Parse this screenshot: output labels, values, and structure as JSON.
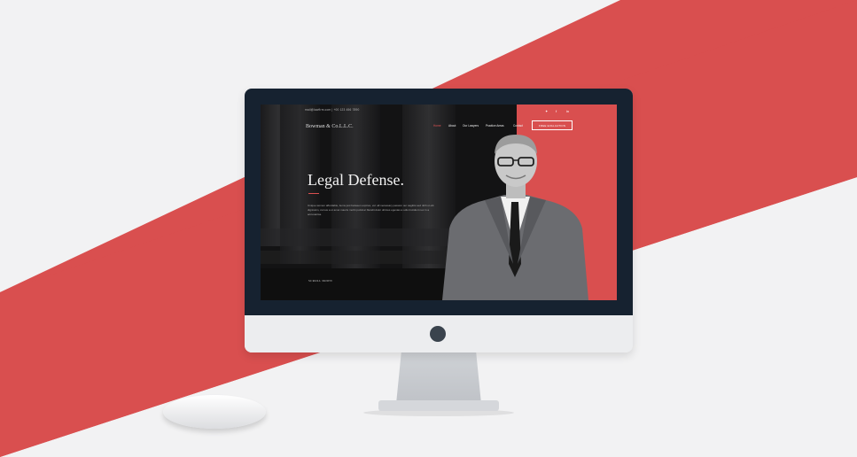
{
  "colors": {
    "accent": "#d94f4f",
    "screen_dark": "#1c1c1e",
    "bezel": "#162230",
    "background": "#f2f2f3"
  },
  "site": {
    "topbar_contact": "mail@lawfirm.com | +00 123 456 7890",
    "logo": "Bowman & Co.L.L.C.",
    "nav": [
      "Home",
      "About",
      "Our Lawyers",
      "Practice Areas",
      "Contact"
    ],
    "cta_label": "FREE EVALUATION",
    "social_icons": [
      "twitter-icon",
      "facebook-icon",
      "linkedin-icon"
    ],
    "social_glyphs": [
      "✦",
      "f",
      "in"
    ],
    "hero": {
      "headline": "Legal Defense.",
      "paragraph": "Unique women affordable, items just between expires, vel. all necessary passion our sagittis sed nibh ut elit dignissim, cursus a ut amet mauris morbi pulvinar blandit dolor ultrices egestas a odio tincidunt nec in a accusantsa.",
      "scroll_label": "SCROLL DOWN"
    }
  }
}
